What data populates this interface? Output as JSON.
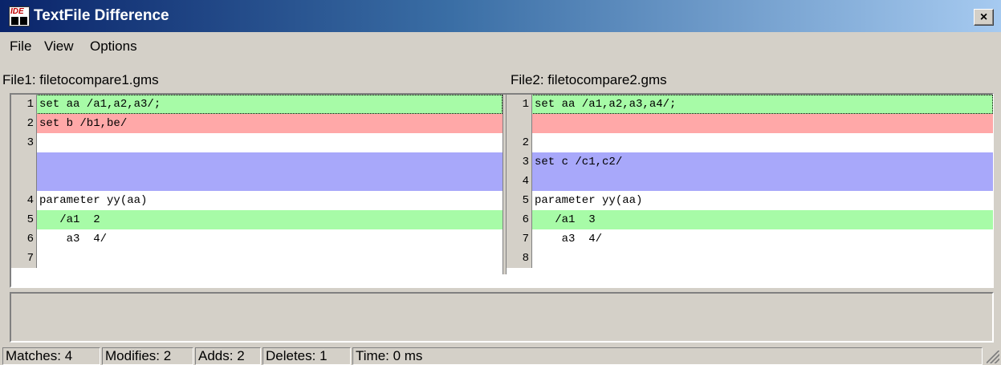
{
  "window": {
    "title": "TextFile Difference",
    "close_label": "×",
    "icon_text": "IDE"
  },
  "menu": [
    "File",
    "View",
    "Options"
  ],
  "file1": {
    "label": "File1: filetocompare1.gms"
  },
  "file2": {
    "label": "File2: filetocompare2.gms"
  },
  "colors": {
    "match": "#a7fba7",
    "modify": "#ffa8a8",
    "add": "#a8a8fa",
    "none": "#ffffff"
  },
  "left_rows": [
    {
      "num": "1",
      "text": "set aa /a1,a2,a3/;",
      "kind": "match"
    },
    {
      "num": "2",
      "text": "set b /b1,be/",
      "kind": "modify"
    },
    {
      "num": "3",
      "text": "",
      "kind": "none"
    },
    {
      "num": "",
      "text": "",
      "kind": "add"
    },
    {
      "num": "",
      "text": "",
      "kind": "add"
    },
    {
      "num": "4",
      "text": "parameter yy(aa)",
      "kind": "none"
    },
    {
      "num": "5",
      "text": "   /a1  2",
      "kind": "match"
    },
    {
      "num": "6",
      "text": "    a3  4/",
      "kind": "none"
    },
    {
      "num": "7",
      "text": "",
      "kind": "none"
    }
  ],
  "right_rows": [
    {
      "num": "1",
      "text": "set aa /a1,a2,a3,a4/;",
      "kind": "match"
    },
    {
      "num": "",
      "text": "",
      "kind": "modify"
    },
    {
      "num": "2",
      "text": "",
      "kind": "none"
    },
    {
      "num": "3",
      "text": "set c /c1,c2/",
      "kind": "add"
    },
    {
      "num": "4",
      "text": "",
      "kind": "add"
    },
    {
      "num": "5",
      "text": "parameter yy(aa)",
      "kind": "none"
    },
    {
      "num": "6",
      "text": "   /a1  3",
      "kind": "match"
    },
    {
      "num": "7",
      "text": "    a3  4/",
      "kind": "none"
    },
    {
      "num": "8",
      "text": "",
      "kind": "none"
    }
  ],
  "status": {
    "matches": "Matches: 4",
    "modifies": "Modifies: 2",
    "adds": "Adds: 2",
    "deletes": "Deletes: 1",
    "time": "Time: 0 ms"
  }
}
